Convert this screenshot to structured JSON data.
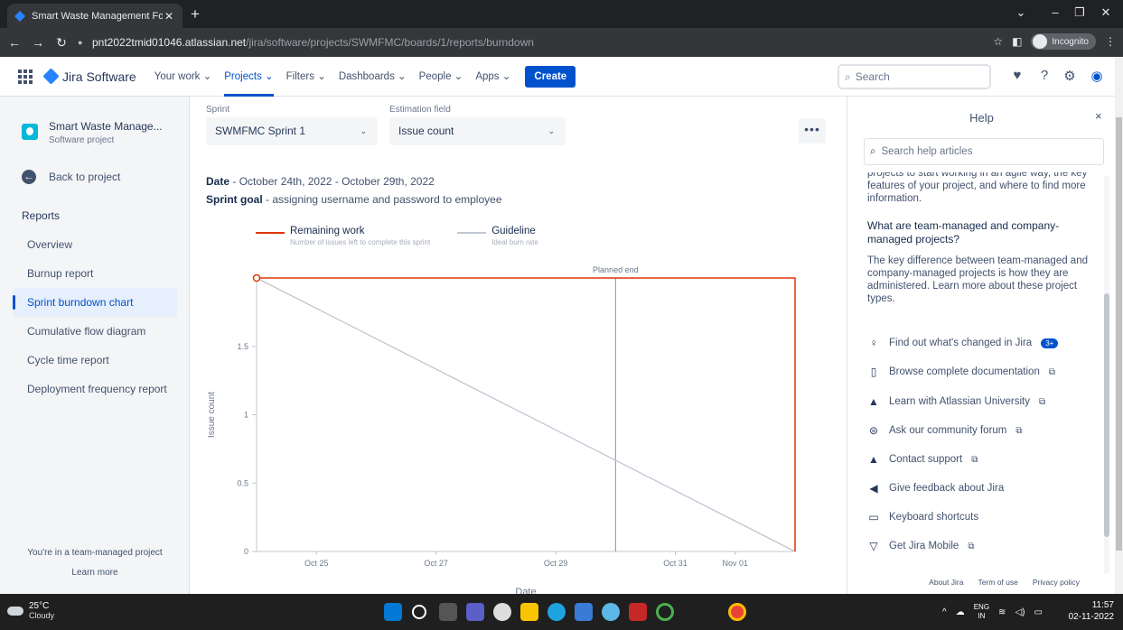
{
  "browser": {
    "tab_title": "Smart Waste Management For M",
    "url_host": "pnt2022tmid01046.atlassian.net",
    "url_path": "/jira/software/projects/SWMFMC/boards/1/reports/burndown",
    "incognito_label": "Incognito"
  },
  "header": {
    "product": "Jira Software",
    "nav": [
      "Your work",
      "Projects",
      "Filters",
      "Dashboards",
      "People",
      "Apps"
    ],
    "active_nav": "Projects",
    "create_label": "Create",
    "search_placeholder": "Search"
  },
  "sidebar": {
    "project_name": "Smart Waste Manage...",
    "project_type": "Software project",
    "back_label": "Back to project",
    "reports_heading": "Reports",
    "items": [
      "Overview",
      "Burnup report",
      "Sprint burndown chart",
      "Cumulative flow diagram",
      "Cycle time report",
      "Deployment frequency report"
    ],
    "active_item": "Sprint burndown chart",
    "team_note": "You're in a team-managed project",
    "learn_more": "Learn more"
  },
  "report": {
    "sprint_label": "Sprint",
    "sprint_value": "SWMFMC Sprint 1",
    "estimation_label": "Estimation field",
    "estimation_value": "Issue count",
    "more_label": "•••",
    "date_label": "Date",
    "date_value": "October 24th, 2022 - October 29th, 2022",
    "goal_label": "Sprint goal",
    "goal_value": "assigning username and password to employee"
  },
  "chart_data": {
    "type": "line",
    "ylabel": "Issue count",
    "xlabel": "Date",
    "ylim": [
      0,
      2
    ],
    "yticks": [
      0,
      0.5,
      1,
      1.5
    ],
    "ytick_labels": [
      "0",
      "0.5",
      "1",
      "1.5"
    ],
    "xticks": [
      "Oct 25",
      "Oct 27",
      "Oct 29",
      "Oct 31",
      "Nov 01"
    ],
    "xrange": [
      "Oct 24",
      "Nov 02"
    ],
    "annotation": "Planned end",
    "annotation_x": "Oct 30",
    "series": [
      {
        "name": "Remaining work",
        "subtitle": "Number of issues left to complete this sprint",
        "color": "#de350b",
        "x": [
          "Oct 24",
          "Nov 02"
        ],
        "values": [
          2,
          2
        ]
      },
      {
        "name": "Guideline",
        "subtitle": "Ideal burn rate",
        "color": "#c1c7d0",
        "x": [
          "Oct 24",
          "Nov 02"
        ],
        "values": [
          2,
          0
        ]
      }
    ]
  },
  "help": {
    "title": "Help",
    "close": "×",
    "search_placeholder": "Search help articles",
    "cut_line": "projects to start working in an agile way, the key",
    "p1": "features of your project, and where to find more information.",
    "heading": "What are team-managed and company-managed projects?",
    "p2": "The key difference between team-managed and company-managed projects is how they are administered. Learn more about these project types.",
    "links": [
      "Find out what's changed in Jira",
      "Browse complete documentation",
      "Learn with Atlassian University",
      "Ask our community forum",
      "Contact support",
      "Give feedback about Jira",
      "Keyboard shortcuts",
      "Get Jira Mobile"
    ],
    "badge": "3+",
    "footer": [
      "About Jira",
      "Term of use",
      "Privacy policy"
    ]
  },
  "taskbar": {
    "temp": "25°C",
    "weather": "Cloudy",
    "lang1": "ENG",
    "lang2": "IN",
    "time": "11:57",
    "date": "02-11-2022"
  }
}
